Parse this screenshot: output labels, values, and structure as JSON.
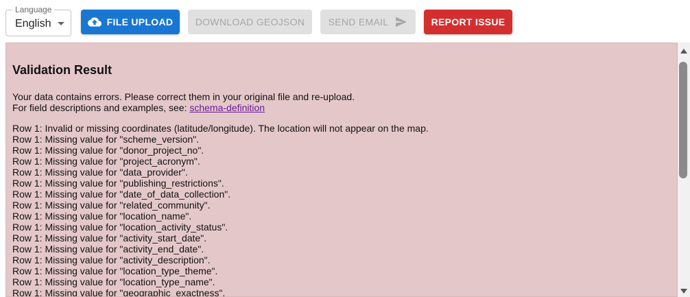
{
  "language": {
    "legend": "Language",
    "selected": "English"
  },
  "toolbar": {
    "upload_label": "FILE UPLOAD",
    "geojson_label": "DOWNLOAD GEOJSON",
    "email_label": "SEND EMAIL",
    "report_label": "REPORT ISSUE"
  },
  "colors": {
    "primary": "#1976d2",
    "error": "#d32f2f",
    "disabled": "#e0e0e0",
    "panel_background": "#e4c7c9"
  },
  "result": {
    "title": "Validation Result",
    "intro_line1": "Your data contains errors. Please correct them in your original file and re-upload.",
    "intro_line2_prefix": "For field descriptions and examples, see: ",
    "schema_link": "schema-definition",
    "errors": [
      "Row 1: Invalid or missing coordinates (latitude/longitude). The location will not appear on the map.",
      "Row 1: Missing value for \"scheme_version\".",
      "Row 1: Missing value for \"donor_project_no\".",
      "Row 1: Missing value for \"project_acronym\".",
      "Row 1: Missing value for \"data_provider\".",
      "Row 1: Missing value for \"publishing_restrictions\".",
      "Row 1: Missing value for \"date_of_data_collection\".",
      "Row 1: Missing value for \"related_community\".",
      "Row 1: Missing value for \"location_name\".",
      "Row 1: Missing value for \"location_activity_status\".",
      "Row 1: Missing value for \"activity_start_date\".",
      "Row 1: Missing value for \"activity_end_date\".",
      "Row 1: Missing value for \"activity_description\".",
      "Row 1: Missing value for \"location_type_theme\".",
      "Row 1: Missing value for \"location_type_name\".",
      "Row 1: Missing value for \"geographic_exactness\"."
    ]
  }
}
